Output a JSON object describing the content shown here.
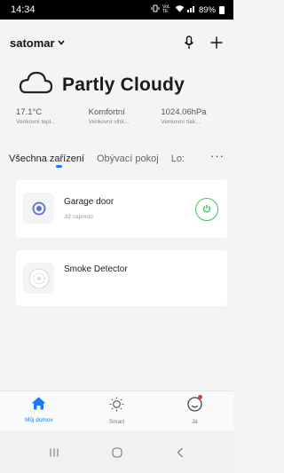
{
  "status_bar": {
    "time": "14:34",
    "network": "VoLTE",
    "battery": "89%"
  },
  "header": {
    "home_name": "satomar"
  },
  "weather": {
    "condition": "Partly Cloudy",
    "stats": [
      {
        "value": "17.1°C",
        "label": "Venkovní tepl..."
      },
      {
        "value": "Komfortní",
        "label": "Venkovní vlhk..."
      },
      {
        "value": "1024.06hPa",
        "label": "Venkovní tlak..."
      }
    ]
  },
  "tabs": {
    "items": [
      "Všechna zařízení",
      "Obývací pokoj",
      "Lo:"
    ],
    "more": "···"
  },
  "devices": [
    {
      "name": "Garage door",
      "status": "Již zapnuto",
      "power_color": "#3bc46a"
    },
    {
      "name": "Smoke Detector"
    }
  ],
  "bottom_nav": [
    {
      "label": "Můj domov",
      "icon": "home-icon"
    },
    {
      "label": "Smart",
      "icon": "sun-icon"
    },
    {
      "label": "Já",
      "icon": "profile-icon"
    }
  ],
  "colors": {
    "accent": "#1e78f0",
    "power": "#3bc46a",
    "badge": "#e53935"
  }
}
